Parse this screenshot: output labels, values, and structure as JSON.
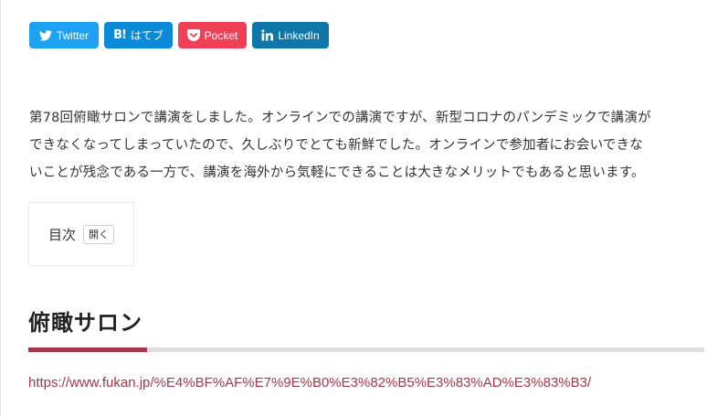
{
  "share": {
    "twitter": {
      "label": "Twitter",
      "icon": "twitter-bird-icon",
      "color": "#1da1f2"
    },
    "hatena": {
      "label": "はてブ",
      "mark": "B!",
      "icon": "hatena-bookmark-icon",
      "color": "#0b8ad8"
    },
    "pocket": {
      "label": "Pocket",
      "icon": "pocket-icon",
      "color": "#ef4056"
    },
    "linkedin": {
      "label": "LinkedIn",
      "icon": "linkedin-icon",
      "color": "#0e76a8"
    }
  },
  "article": {
    "intro_line1": "第78回俯瞰サロンで講演をしました。オンラインでの講演ですが、新型コロナのパンデミックで講演が",
    "intro_line2": "できなくなってしまっていたので、久しぶりでとても新鮮でした。オンラインで参加者にお会いできな",
    "intro_line3": "いことが残念である一方で、講演を海外から気軽にできることは大きなメリットでもあると思います。"
  },
  "toc": {
    "title": "目次",
    "toggle_label": "開く"
  },
  "section": {
    "heading": "俯瞰サロン",
    "accent_color": "#a8354a",
    "link_text": "https://www.fukan.jp/%E4%BF%AF%E7%9E%B0%E3%82%B5%E3%83%AD%E3%83%B3/"
  }
}
